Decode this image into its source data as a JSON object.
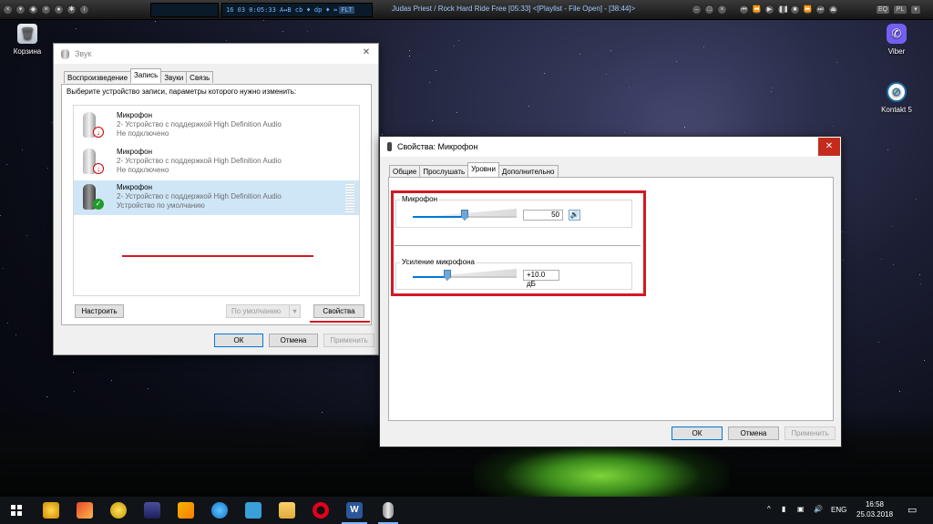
{
  "player": {
    "lcd_left": "16   03   0:05:33   A↔B  cb  ♦  dp ♦  ≈  ",
    "lcd_tag": "FLT",
    "track": "Judas Priest / Rock Hard Ride Free  [05:33]    <[Playlist - File Open] - [38:44]>"
  },
  "desktop": {
    "recycle_bin": "Корзина",
    "viber": "Viber",
    "kontakt": "Kontakt 5"
  },
  "sound_window": {
    "title": "Звук",
    "tabs": [
      "Воспроизведение",
      "Запись",
      "Звуки",
      "Связь"
    ],
    "active_tab": "Запись",
    "instruction": "Выберите устройство записи, параметры которого нужно изменить:",
    "devices": [
      {
        "name": "Микрофон",
        "desc": "2- Устройство с поддержкой High Definition Audio",
        "status": "Не подключено"
      },
      {
        "name": "Микрофон",
        "desc": "2- Устройство с поддержкой High Definition Audio",
        "status": "Не подключено"
      },
      {
        "name": "Микрофон",
        "desc": "2- Устройство с поддержкой High Definition Audio",
        "status": "Устройство по умолчанию"
      }
    ],
    "configure": "Настроить",
    "default": "По умолчанию",
    "properties": "Свойства",
    "ok": "ОК",
    "cancel": "Отмена",
    "apply": "Применить"
  },
  "props_window": {
    "title": "Свойства: Микрофон",
    "tabs": [
      "Общие",
      "Прослушать",
      "Уровни",
      "Дополнительно"
    ],
    "active_tab": "Уровни",
    "mic_label": "Микрофон",
    "mic_value": "50",
    "mic_level": 0.5,
    "boost_label": "Усиление микрофона",
    "boost_value": "+10.0 дБ",
    "boost_level": 0.33,
    "ok": "ОК",
    "cancel": "Отмена",
    "apply": "Применить"
  },
  "taskbar": {
    "lang": "ENG",
    "time": "16:58",
    "date": "25.03.2018"
  },
  "colors": {
    "accent": "#0078d7",
    "highlight_red": "#d31823",
    "close_red": "#c42b1c",
    "selected_row": "#cfe6f7"
  }
}
